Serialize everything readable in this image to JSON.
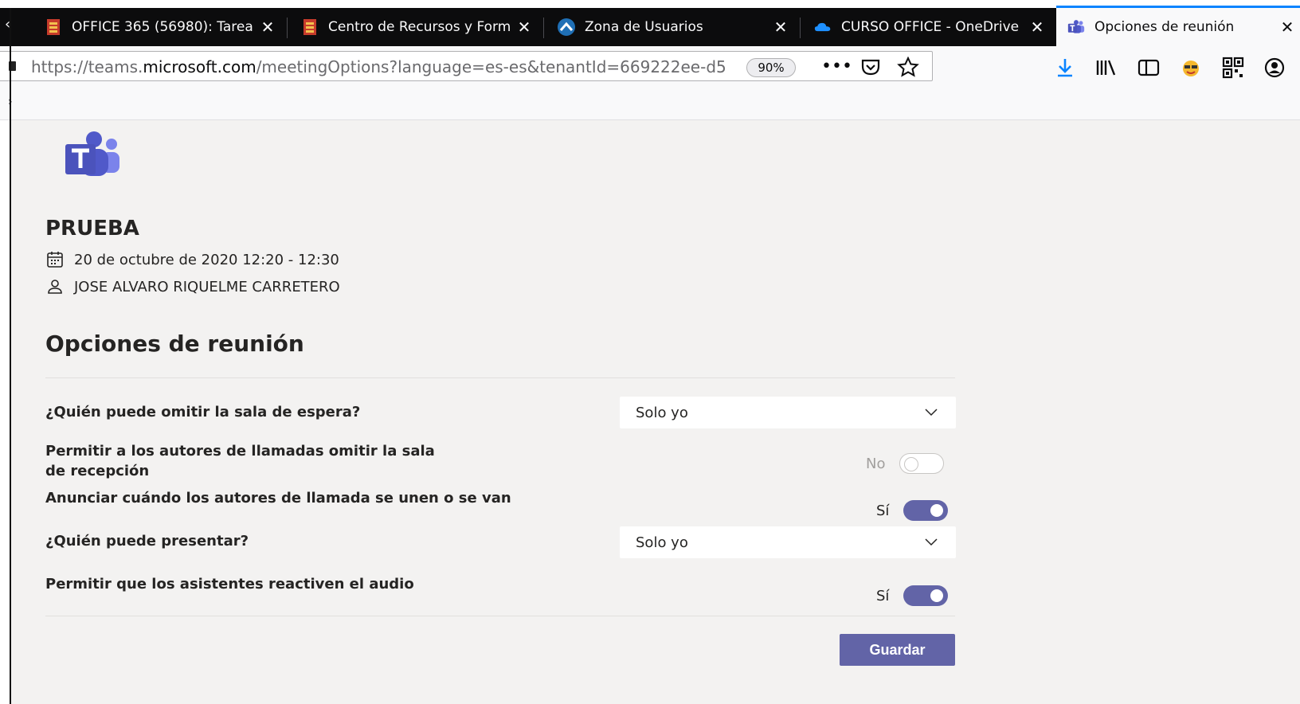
{
  "browser": {
    "tabs": [
      {
        "title": "OFFICE 365 (56980): Tarea",
        "icon": "office-doc-icon",
        "active": false
      },
      {
        "title": "Centro de Recursos y Form",
        "icon": "office-doc-icon",
        "active": false
      },
      {
        "title": "Zona de Usuarios",
        "icon": "zona-usuarios-icon",
        "active": false
      },
      {
        "title": "CURSO OFFICE - OneDrive",
        "icon": "onedrive-cloud-icon",
        "active": false
      },
      {
        "title": "Opciones de reunión",
        "icon": "teams-icon",
        "active": true
      }
    ],
    "url_prefix": "https://teams.",
    "url_domain": "microsoft.com",
    "url_path": "/meetingOptions?language=es-es&tenantId=669222ee-d5",
    "zoom": "90%",
    "colors": {
      "accent": "#0a84ff",
      "tabbar": "#0c0c0d"
    }
  },
  "meeting": {
    "title": "PRUEBA",
    "datetime": "20 de octubre de 2020 12:20 - 12:30",
    "organizer": "JOSE ALVARO RIQUELME CARRETERO"
  },
  "options": {
    "heading": "Opciones de reunión",
    "lobby_bypass": {
      "label": "¿Quién puede omitir la sala de espera?",
      "value": "Solo yo"
    },
    "callers_bypass": {
      "label": "Permitir a los autores de llamadas omitir la sala de recepción",
      "state": "No",
      "enabled": false
    },
    "announce_callers": {
      "label": "Anunciar cuándo los autores de llamada se unen o se van",
      "state": "Sí",
      "enabled": true
    },
    "presenters": {
      "label": "¿Quién puede presentar?",
      "value": "Solo yo"
    },
    "unmute": {
      "label": "Permitir que los asistentes reactiven el audio",
      "state": "Sí",
      "enabled": true
    },
    "save_label": "Guardar"
  },
  "colors": {
    "teams_purple": "#6264a7",
    "page_bg": "#f3f2f1"
  }
}
